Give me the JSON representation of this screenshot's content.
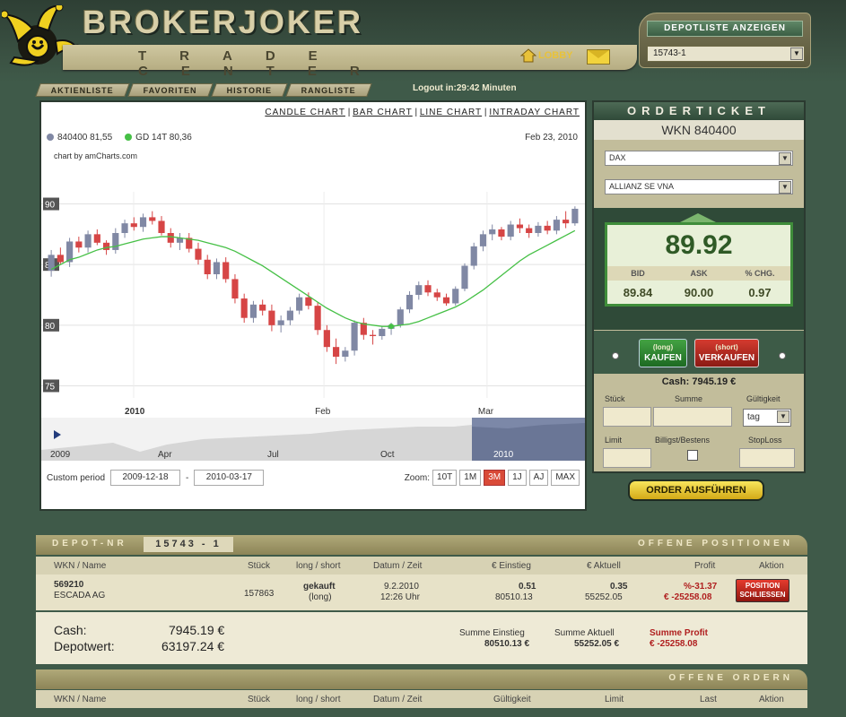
{
  "header": {
    "brand": "BROKERJOKER",
    "tagline": "TRADE CENTER",
    "lobby": "LOBBY",
    "depot_button": "DEPOTLISTE ANZEIGEN",
    "depot_select": "15743-1"
  },
  "tabs": [
    "AKTIENLISTE",
    "FAVORITEN",
    "HISTORIE",
    "RANGLISTE"
  ],
  "logout": "Logout in:29:42 Minuten",
  "chart_links": [
    "CANDLE CHART",
    "BAR CHART",
    "LINE CHART",
    "INTRADAY CHART"
  ],
  "legend": {
    "series1": "840400 81,55",
    "series2": "GD 14T 80,36",
    "credit": "chart by amCharts.com",
    "date": "Feb 23, 2010"
  },
  "colors": {
    "up": "#8088a4",
    "down": "#d64545",
    "ma": "#46c046",
    "price_green": "#2f5a26"
  },
  "chart_data": {
    "type": "bar",
    "title": "",
    "y_ticks": [
      75,
      80,
      85,
      90
    ],
    "x_ticks": [
      "2010",
      "Feb",
      "Mar"
    ],
    "ylim": [
      74,
      91
    ],
    "series": [
      {
        "name": "840400",
        "kind": "candlestick",
        "ohlc": [
          [
            84.5,
            86.2,
            84.0,
            85.8
          ],
          [
            85.8,
            86.4,
            85.0,
            85.2
          ],
          [
            85.2,
            87.2,
            84.8,
            86.9
          ],
          [
            86.9,
            87.3,
            86.0,
            86.4
          ],
          [
            86.4,
            87.8,
            86.0,
            87.5
          ],
          [
            87.5,
            87.9,
            86.6,
            86.8
          ],
          [
            86.8,
            87.0,
            85.8,
            86.2
          ],
          [
            86.2,
            88.0,
            85.9,
            87.6
          ],
          [
            87.6,
            88.7,
            87.2,
            88.4
          ],
          [
            88.4,
            88.9,
            87.8,
            88.1
          ],
          [
            88.1,
            89.2,
            87.7,
            88.9
          ],
          [
            88.9,
            89.4,
            88.3,
            88.6
          ],
          [
            88.6,
            89.0,
            87.4,
            87.6
          ],
          [
            87.6,
            88.0,
            86.4,
            86.8
          ],
          [
            86.8,
            87.6,
            86.2,
            87.2
          ],
          [
            87.2,
            87.6,
            86.0,
            86.3
          ],
          [
            86.3,
            86.8,
            85.0,
            85.4
          ],
          [
            85.4,
            85.8,
            83.8,
            84.2
          ],
          [
            84.2,
            85.5,
            83.8,
            85.2
          ],
          [
            85.2,
            85.6,
            83.5,
            83.8
          ],
          [
            83.8,
            84.2,
            81.8,
            82.2
          ],
          [
            82.2,
            82.6,
            80.2,
            80.6
          ],
          [
            80.6,
            82.0,
            80.2,
            81.7
          ],
          [
            81.7,
            82.1,
            80.8,
            81.2
          ],
          [
            81.2,
            81.7,
            79.5,
            80.0
          ],
          [
            80.0,
            80.8,
            79.4,
            80.4
          ],
          [
            80.4,
            81.5,
            80.0,
            81.2
          ],
          [
            81.2,
            82.6,
            80.9,
            82.3
          ],
          [
            82.3,
            82.7,
            81.3,
            81.6
          ],
          [
            81.6,
            81.9,
            79.2,
            79.6
          ],
          [
            79.6,
            80.0,
            77.8,
            78.2
          ],
          [
            78.2,
            78.9,
            76.8,
            77.4
          ],
          [
            77.4,
            78.2,
            77.0,
            77.9
          ],
          [
            77.9,
            80.4,
            77.5,
            80.2
          ],
          [
            80.2,
            80.6,
            78.8,
            79.2
          ],
          [
            79.2,
            79.6,
            78.4,
            79.1
          ],
          [
            79.1,
            79.9,
            78.8,
            79.7
          ],
          [
            79.7,
            80.2,
            79.2,
            80.0
          ],
          [
            80.0,
            81.5,
            79.8,
            81.3
          ],
          [
            81.3,
            82.8,
            81.0,
            82.5
          ],
          [
            82.5,
            83.6,
            82.1,
            83.3
          ],
          [
            83.3,
            83.7,
            82.4,
            82.7
          ],
          [
            82.7,
            83.0,
            82.0,
            82.3
          ],
          [
            82.3,
            82.6,
            81.6,
            81.8
          ],
          [
            81.8,
            83.2,
            81.6,
            83.0
          ],
          [
            83.0,
            85.1,
            82.8,
            84.9
          ],
          [
            84.9,
            86.8,
            84.6,
            86.5
          ],
          [
            86.5,
            87.8,
            86.1,
            87.5
          ],
          [
            87.5,
            88.3,
            87.0,
            87.9
          ],
          [
            87.9,
            88.1,
            87.0,
            87.3
          ],
          [
            87.3,
            88.6,
            87.0,
            88.3
          ],
          [
            88.3,
            88.8,
            87.6,
            88.0
          ],
          [
            88.0,
            88.3,
            87.2,
            87.6
          ],
          [
            87.6,
            88.5,
            87.3,
            88.2
          ],
          [
            88.2,
            88.6,
            87.5,
            87.8
          ],
          [
            87.8,
            89.0,
            87.5,
            88.7
          ],
          [
            88.7,
            89.4,
            88.0,
            88.4
          ],
          [
            88.4,
            89.8,
            88.2,
            89.6
          ]
        ]
      },
      {
        "name": "GD 14T",
        "kind": "line",
        "values": [
          84.6,
          85.0,
          85.4,
          85.6,
          85.9,
          86.2,
          86.4,
          86.5,
          86.7,
          86.9,
          87.1,
          87.2,
          87.3,
          87.3,
          87.2,
          87.1,
          87.0,
          86.8,
          86.6,
          86.4,
          86.1,
          85.7,
          85.3,
          84.9,
          84.4,
          83.9,
          83.4,
          82.9,
          82.4,
          81.9,
          81.4,
          81.0,
          80.6,
          80.3,
          80.1,
          80.0,
          79.9,
          79.9,
          80.0,
          80.1,
          80.3,
          80.6,
          80.9,
          81.2,
          81.5,
          81.9,
          82.4,
          82.9,
          83.5,
          84.1,
          84.7,
          85.3,
          85.8,
          86.2,
          86.6,
          87.0,
          87.4,
          87.8
        ]
      }
    ]
  },
  "navigator": {
    "labels": [
      "2009",
      "Apr",
      "Jul",
      "Oct",
      "2010"
    ]
  },
  "period": {
    "label": "Custom period",
    "from": "2009-12-18",
    "to": "2010-03-17"
  },
  "zoom": {
    "label": "Zoom:",
    "buttons": [
      "10T",
      "1M",
      "3M",
      "1J",
      "AJ",
      "MAX"
    ],
    "active": "3M"
  },
  "orderticket": {
    "title": "ORDERTICKET",
    "wkn": "WKN 840400",
    "index": "DAX",
    "stock": "ALLIANZ SE VNA",
    "price": "89.92",
    "bid_label": "BID",
    "ask_label": "ASK",
    "chg_label": "% CHG.",
    "bid": "89.84",
    "ask": "90.00",
    "chg": "0.97",
    "buy_small": "(long)",
    "buy": "KAUFEN",
    "sell_small": "(short)",
    "sell": "VERKAUFEN",
    "cash": "Cash: 7945.19 €",
    "stueck": "Stück",
    "summe": "Summe",
    "gueltig": "Gültigkeit",
    "tag": "tag",
    "limit": "Limit",
    "billigst": "Billigst/Bestens",
    "stoploss": "StopLoss",
    "execute": "ORDER AUSFÜHREN"
  },
  "depot": {
    "label": "DEPOT-NR",
    "nr": "15743 - 1",
    "right": "OFFENE POSITIONEN",
    "headers": [
      "WKN / Name",
      "Stück",
      "long / short",
      "Datum / Zeit",
      "€ Einstieg",
      "€ Aktuell",
      "Profit",
      "Aktion"
    ],
    "row": {
      "wkn": "569210",
      "name": "ESCADA AG",
      "stueck": "157863",
      "type1": "gekauft",
      "type2": "(long)",
      "date": "9.2.2010",
      "time": "12:26 Uhr",
      "einstieg1": "0.51",
      "einstieg2": "80510.13",
      "aktuell1": "0.35",
      "aktuell2": "55252.05",
      "profit1": "%-31.37",
      "profit2": "€ -25258.08",
      "action1": "POSITION",
      "action2": "SCHLIESSEN"
    },
    "cash_label": "Cash:",
    "cash": "7945.19 €",
    "depotwert_label": "Depotwert:",
    "depotwert": "63197.24 €",
    "sum_einstieg_label": "Summe Einstieg",
    "sum_einstieg": "80510.13 €",
    "sum_aktuell_label": "Summe Aktuell",
    "sum_aktuell": "55252.05 €",
    "sum_profit_label": "Summe Profit",
    "sum_profit": "€ -25258.08"
  },
  "orders": {
    "right": "OFFENE ORDERN",
    "headers": [
      "WKN / Name",
      "Stück",
      "long / short",
      "Datum / Zeit",
      "Gültigkeit",
      "Limit",
      "Last",
      "Aktion"
    ]
  }
}
